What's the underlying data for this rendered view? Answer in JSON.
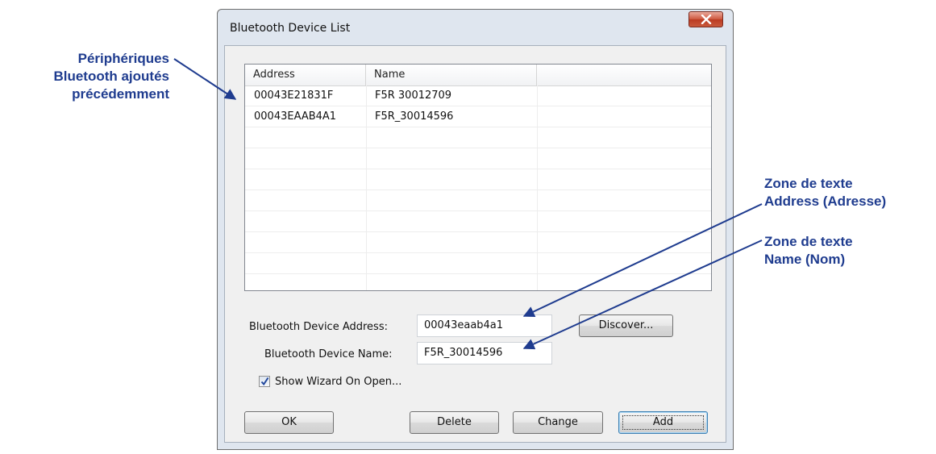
{
  "window": {
    "title": "Bluetooth Device List"
  },
  "list": {
    "columns": [
      "Address",
      "Name",
      ""
    ],
    "rows": [
      {
        "address": "00043E21831F",
        "name": "F5R 30012709"
      },
      {
        "address": "00043EAAB4A1",
        "name": "F5R_30014596"
      }
    ]
  },
  "form": {
    "address_label": "Bluetooth Device Address:",
    "address_value": "00043eaab4a1",
    "name_label": "Bluetooth Device Name:",
    "name_value": "F5R_30014596",
    "discover_label": "Discover...",
    "show_wizard_label": "Show Wizard On Open...",
    "show_wizard_checked": true
  },
  "buttons": {
    "ok": "OK",
    "delete": "Delete",
    "change": "Change",
    "add": "Add"
  },
  "callouts": {
    "devices": [
      "Périphériques",
      "Bluetooth ajoutés",
      "précédemment"
    ],
    "address": [
      "Zone de texte",
      "Address (Adresse)"
    ],
    "name": [
      "Zone de texte",
      "Name (Nom)"
    ]
  },
  "colors": {
    "callout": "#1f3c8f",
    "close_button": "#c9533a"
  },
  "icons": {
    "close": "close-icon",
    "checkbox": "checkmark-icon"
  }
}
